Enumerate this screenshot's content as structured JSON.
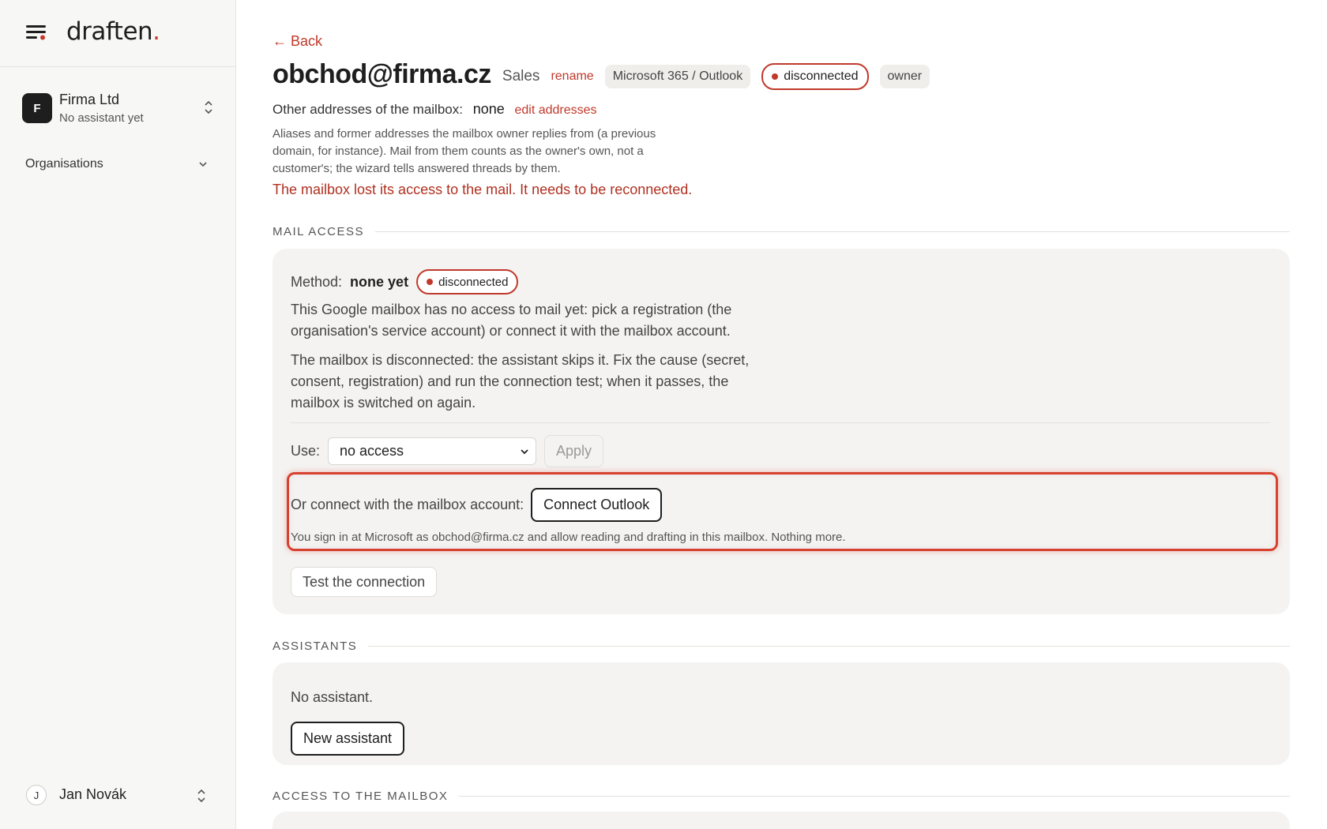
{
  "app": {
    "logo_text": "draften",
    "logo_dot": "."
  },
  "sidebar": {
    "org": {
      "initial": "F",
      "name": "Firma Ltd",
      "subtitle": "No assistant yet"
    },
    "organisations_label": "Organisations",
    "user": {
      "initial": "J",
      "name": "Jan Novák"
    }
  },
  "header": {
    "back_label": "← Back",
    "mailbox_address": "obchod@firma.cz",
    "mailbox_label": "Sales",
    "rename_label": "rename",
    "provider": "Microsoft 365 / Outlook",
    "status": "disconnected",
    "role": "owner"
  },
  "other_addresses": {
    "label": "Other addresses of the mailbox:",
    "value": "none",
    "edit_label": "edit addresses",
    "hint": "Aliases and former addresses the mailbox owner replies from (a previous domain, for instance). Mail from them counts as the owner's own, not a customer's; the wizard tells answered threads by them."
  },
  "error_message": "The mailbox lost its access to the mail. It needs to be reconnected.",
  "mail_access": {
    "heading": "MAIL ACCESS",
    "method_label": "Method:",
    "method_value": "none yet",
    "status": "disconnected",
    "para1": "This Google mailbox has no access to mail yet: pick a registration (the organisation's service account) or connect it with the mailbox account.",
    "para2": "The mailbox is disconnected: the assistant skips it. Fix the cause (secret, consent, registration) and run the connection test; when it passes, the mailbox is switched on again.",
    "use_label": "Use:",
    "use_selected": "no access",
    "apply_label": "Apply",
    "connect_label": "Or connect with the mailbox account:",
    "connect_button": "Connect Outlook",
    "signin_note": "You sign in at Microsoft as obchod@firma.cz and allow reading and drafting in this mailbox. Nothing more.",
    "test_button": "Test the connection"
  },
  "assistants": {
    "heading": "ASSISTANTS",
    "empty_text": "No assistant.",
    "new_button": "New assistant"
  },
  "access": {
    "heading": "ACCESS TO THE MAILBOX"
  },
  "colors": {
    "accent": "#c0392b",
    "card_bg": "#f4f3f1",
    "sidebar_bg": "#f7f7f5",
    "highlight": "#d8402f"
  }
}
